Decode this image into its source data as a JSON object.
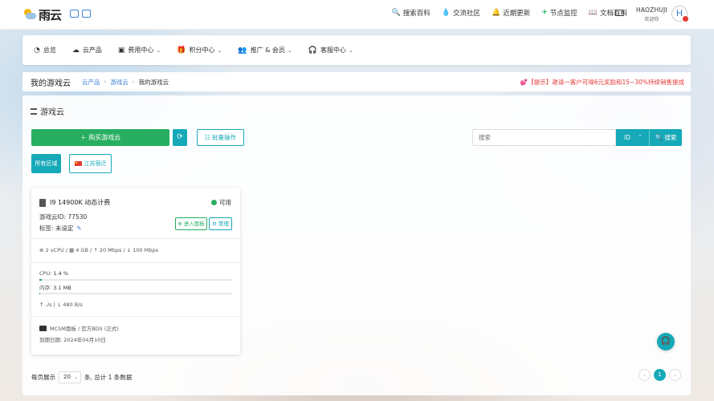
{
  "header": {
    "logo_text": "雨云",
    "links": [
      {
        "icon": "search-icon",
        "glyph": "🔍",
        "label": "搜索百科"
      },
      {
        "icon": "drop-icon",
        "glyph": "💧",
        "label": "交流社区"
      },
      {
        "icon": "bell-icon",
        "glyph": "🔔",
        "label": "近期更新"
      },
      {
        "icon": "pin-icon",
        "glyph": "✈",
        "label": "节点监控"
      },
      {
        "icon": "book-icon",
        "glyph": "📖",
        "label": "文档百科"
      }
    ],
    "user": {
      "name": "HAOZHUJI",
      "subtitle": "欢迎你",
      "avatar_letter": "H"
    }
  },
  "menu": [
    {
      "icon": "dashboard-icon",
      "glyph": "◔",
      "label": "总览",
      "dropdown": false
    },
    {
      "icon": "cloud-icon",
      "glyph": "☁",
      "label": "云产品",
      "dropdown": false
    },
    {
      "icon": "wallet-icon",
      "glyph": "▣",
      "label": "费用中心",
      "dropdown": true
    },
    {
      "icon": "gift-icon",
      "glyph": "🎁",
      "label": "积分中心",
      "dropdown": true
    },
    {
      "icon": "users-icon",
      "glyph": "👥",
      "label": "推广 & 会员",
      "dropdown": true
    },
    {
      "icon": "headset-icon",
      "glyph": "🎧",
      "label": "客服中心",
      "dropdown": true
    }
  ],
  "breadcrumb": {
    "title": "我的游戏云",
    "items": [
      "云产品",
      "游戏云",
      "我的游戏云"
    ],
    "notice": "💕【提示】邀请一客户可得6元奖励和15~30%持续销售提成"
  },
  "panel": {
    "title": "游戏云",
    "buy_button": "＋ 购买游戏云",
    "refresh_glyph": "⟳",
    "batch_button": "☷ 批量操作",
    "search_placeholder": "搜索",
    "search_field": "ID",
    "search_button": "🔍 搜索",
    "regions": [
      "所有区域",
      "江苏宿迁"
    ]
  },
  "card": {
    "title": "I9 14900K 动态计费",
    "status": "可用",
    "id_line": "游戏云ID: 77530",
    "tag_line": "标签: 未设定",
    "enter_button": "⊕ 进入面板",
    "manage_button": "⚙ 管理",
    "specs": "⊕ 2 vCPU / ▦ 4 GB / ↑ 20 Mbps / ↓ 100 Mbps",
    "cpu_label": "CPU: ",
    "cpu_value": "1.4 %",
    "cpu_percent": 1.4,
    "mem_label": "内存: ",
    "mem_value": "3.1 MB",
    "mem_percent": 0.1,
    "network": "↑ -/s   |   ↓ 480 B/s",
    "os": "MCSM面板 / 官方BDS (正式)",
    "expire": "到期日期:  2024年04月10日"
  },
  "pager": {
    "prefix": "每页展示",
    "size": "20",
    "suffix": "条, 总计 1 条数据",
    "current": "1",
    "prev": "‹",
    "next": "›"
  },
  "float_help_glyph": "🎧"
}
